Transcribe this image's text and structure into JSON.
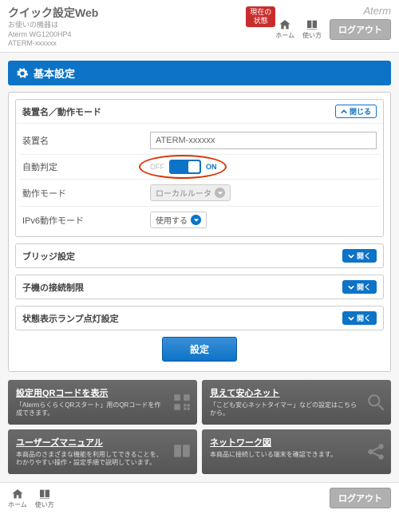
{
  "header": {
    "title": "クイック設定Web",
    "sub1": "お使いの機器は",
    "sub2": "Aterm WG1200HP4",
    "sub3": "ATERM-xxxxxx",
    "current_btn_l1": "現在の",
    "current_btn_l2": "状態",
    "brand": "Aterm",
    "home": "ホーム",
    "howto": "使い方",
    "logout": "ログアウト"
  },
  "banner": {
    "title": "基本設定"
  },
  "sect_main": {
    "title": "装置名／動作モード",
    "close": "閉じる",
    "rows": {
      "device_label": "装置名",
      "device_value": "ATERM-xxxxxx",
      "auto_label": "自動判定",
      "off": "OFF",
      "on": "ON",
      "mode_label": "動作モード",
      "mode_value": "ローカルルータ",
      "ipv6_label": "IPv6動作モード",
      "ipv6_value": "使用する"
    }
  },
  "sects": {
    "bridge": "ブリッジ設定",
    "childlimit": "子機の接続制限",
    "lamp": "状態表示ランプ点灯設定",
    "open": "開く"
  },
  "apply": "設定",
  "cards": {
    "qr_t": "設定用QRコードを表示",
    "qr_s": "「AtermらくらくQRスタート」用のQRコードを作成できます。",
    "safe_t": "見えて安心ネット",
    "safe_s": "「こども安心ネットタイマー」などの設定はこちらから。",
    "manual_t": "ユーザーズマニュアル",
    "manual_s": "本商品のさまざまな機能を利用してできることを、わかりやすい操作・設定手順で説明しています。",
    "net_t": "ネットワーク図",
    "net_s": "本商品に接続している端末を確認できます。"
  }
}
